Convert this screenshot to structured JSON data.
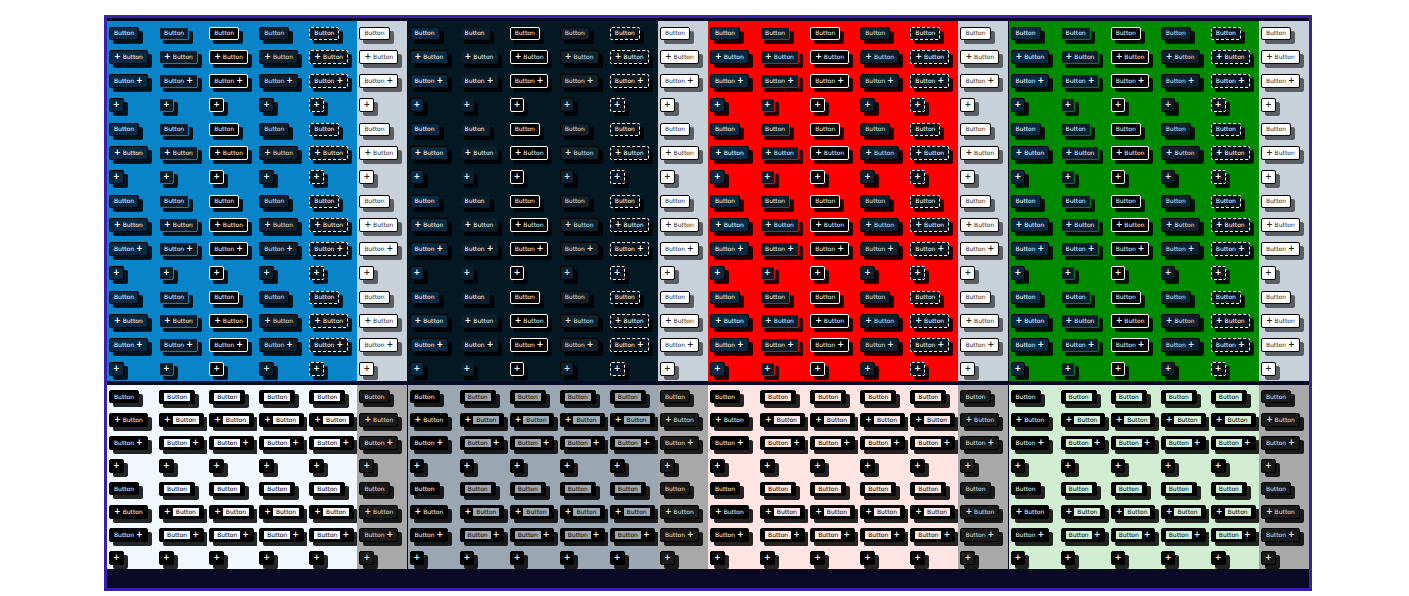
{
  "button_label": "Button",
  "icon_glyph": "+",
  "palettes": [
    {
      "color": "#0a84c8",
      "tint": "#f2f8ff"
    },
    {
      "color": "#031822",
      "tint": "#9aa6b2"
    },
    {
      "color": "#ff0000",
      "tint": "#ffe4e4"
    },
    {
      "color": "#008a00",
      "tint": "#d2eed2"
    }
  ],
  "variants": [
    {
      "kind": "solid",
      "disabled": false
    },
    {
      "kind": "soft",
      "disabled": false
    },
    {
      "kind": "outline",
      "disabled": false
    },
    {
      "kind": "ghost",
      "disabled": false
    },
    {
      "kind": "dashed",
      "disabled": false
    },
    {
      "kind": "plain",
      "disabled": true
    }
  ],
  "sections": [
    {
      "kind": "dark",
      "rows": [
        {
          "kind": "text"
        },
        {
          "kind": "icon-left"
        },
        {
          "kind": "icon-right"
        },
        {
          "kind": "icon"
        },
        {
          "kind": "text"
        },
        {
          "kind": "icon-left"
        },
        {
          "kind": "icon"
        },
        {
          "kind": "text"
        },
        {
          "kind": "icon-left"
        },
        {
          "kind": "icon-right"
        },
        {
          "kind": "icon"
        },
        {
          "kind": "text"
        },
        {
          "kind": "icon-left"
        },
        {
          "kind": "icon-right"
        },
        {
          "kind": "icon"
        }
      ]
    },
    {
      "kind": "light",
      "rows": [
        {
          "kind": "text"
        },
        {
          "kind": "icon-left"
        },
        {
          "kind": "icon-right"
        },
        {
          "kind": "icon"
        },
        {
          "kind": "text"
        },
        {
          "kind": "icon-left"
        },
        {
          "kind": "icon-right"
        },
        {
          "kind": "icon"
        }
      ]
    }
  ]
}
